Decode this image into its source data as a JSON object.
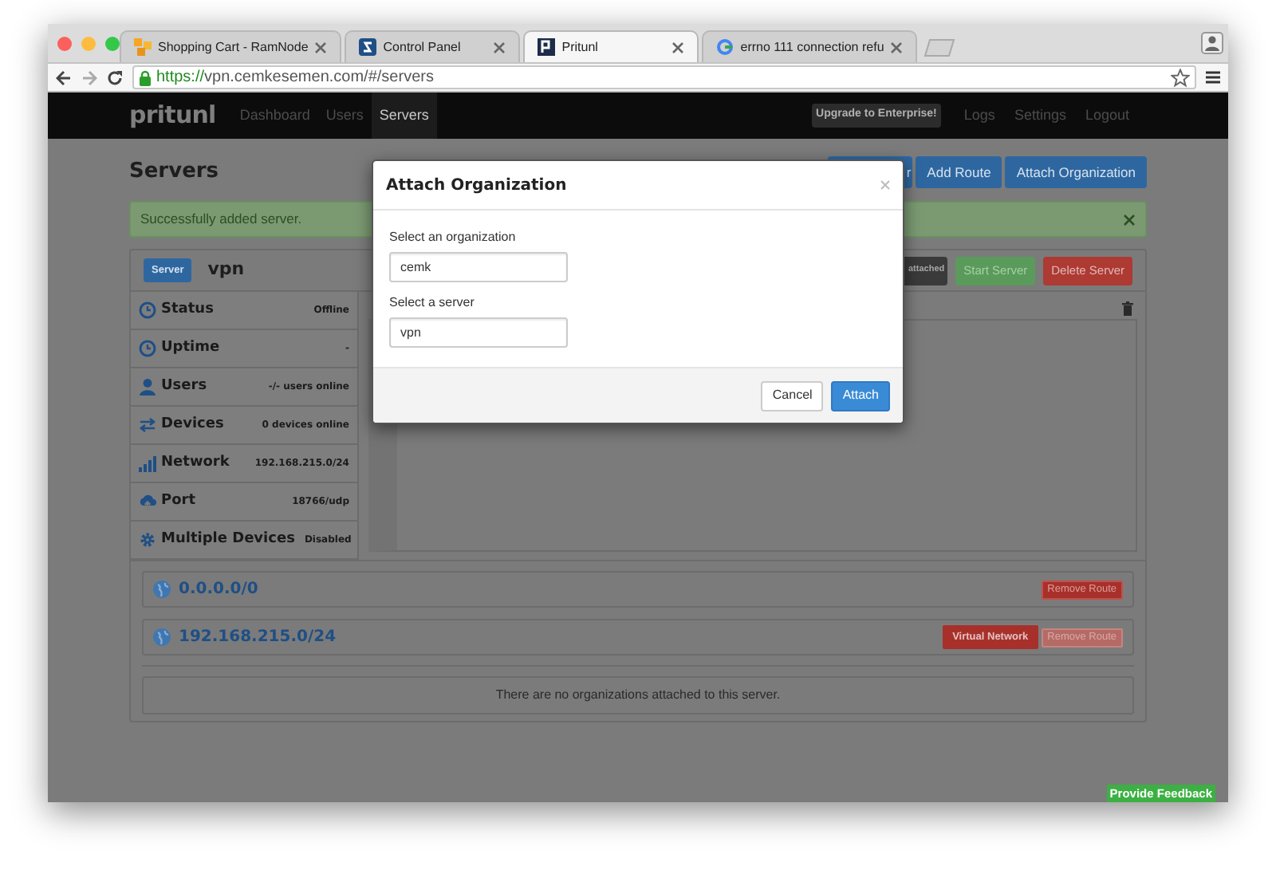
{
  "browser": {
    "tabs": [
      {
        "title": "Shopping Cart - RamNode",
        "selected": false
      },
      {
        "title": "Control Panel",
        "selected": false
      },
      {
        "title": "Pritunl",
        "selected": true
      },
      {
        "title": "errno 111 connection refu",
        "selected": false
      }
    ],
    "url_scheme": "https://",
    "url_rest": "vpn.cemkesemen.com/#/servers"
  },
  "navbar": {
    "brand": "pritunl",
    "links": [
      {
        "label": "Dashboard",
        "selected": false
      },
      {
        "label": "Users",
        "selected": false
      },
      {
        "label": "Servers",
        "selected": true
      }
    ],
    "upgrade": "Upgrade to Enterprise!",
    "right_links": [
      "Logs",
      "Settings",
      "Logout"
    ]
  },
  "page": {
    "title": "Servers",
    "buttons": [
      "r",
      "Add Route",
      "Attach Organization"
    ]
  },
  "alert": {
    "message": "Successfully added server."
  },
  "server": {
    "badge": "Server",
    "name": "vpn",
    "buttons": [
      {
        "label": "attached",
        "kind": "dark"
      },
      {
        "label": "Start Server",
        "kind": "success"
      },
      {
        "label": "Delete Server",
        "kind": "danger"
      }
    ],
    "stats": [
      {
        "label": "Status",
        "value": "Offline"
      },
      {
        "label": "Uptime",
        "value": "-"
      },
      {
        "label": "Users",
        "value": "-/- users online"
      },
      {
        "label": "Devices",
        "value": "0 devices online"
      },
      {
        "label": "Network",
        "value": "192.168.215.0/24"
      },
      {
        "label": "Port",
        "value": "18766/udp"
      },
      {
        "label": "Multiple Devices",
        "value": "Disabled"
      }
    ],
    "routes": [
      {
        "network": "0.0.0.0/0",
        "remove": "Remove Route",
        "disabled": false
      },
      {
        "network": "192.168.215.0/24",
        "badge": "Virtual Network",
        "remove": "Remove Route",
        "disabled": true
      }
    ],
    "organizations_empty": "There are no organizations attached to this server."
  },
  "modal": {
    "title": "Attach Organization",
    "fields": [
      {
        "label": "Select an organization",
        "value": "cemk"
      },
      {
        "label": "Select a server",
        "value": "vpn"
      }
    ],
    "buttons": [
      {
        "label": "Cancel",
        "kind": "default"
      },
      {
        "label": "Attach",
        "kind": "primary"
      }
    ]
  },
  "feedback": "Provide Feedback"
}
